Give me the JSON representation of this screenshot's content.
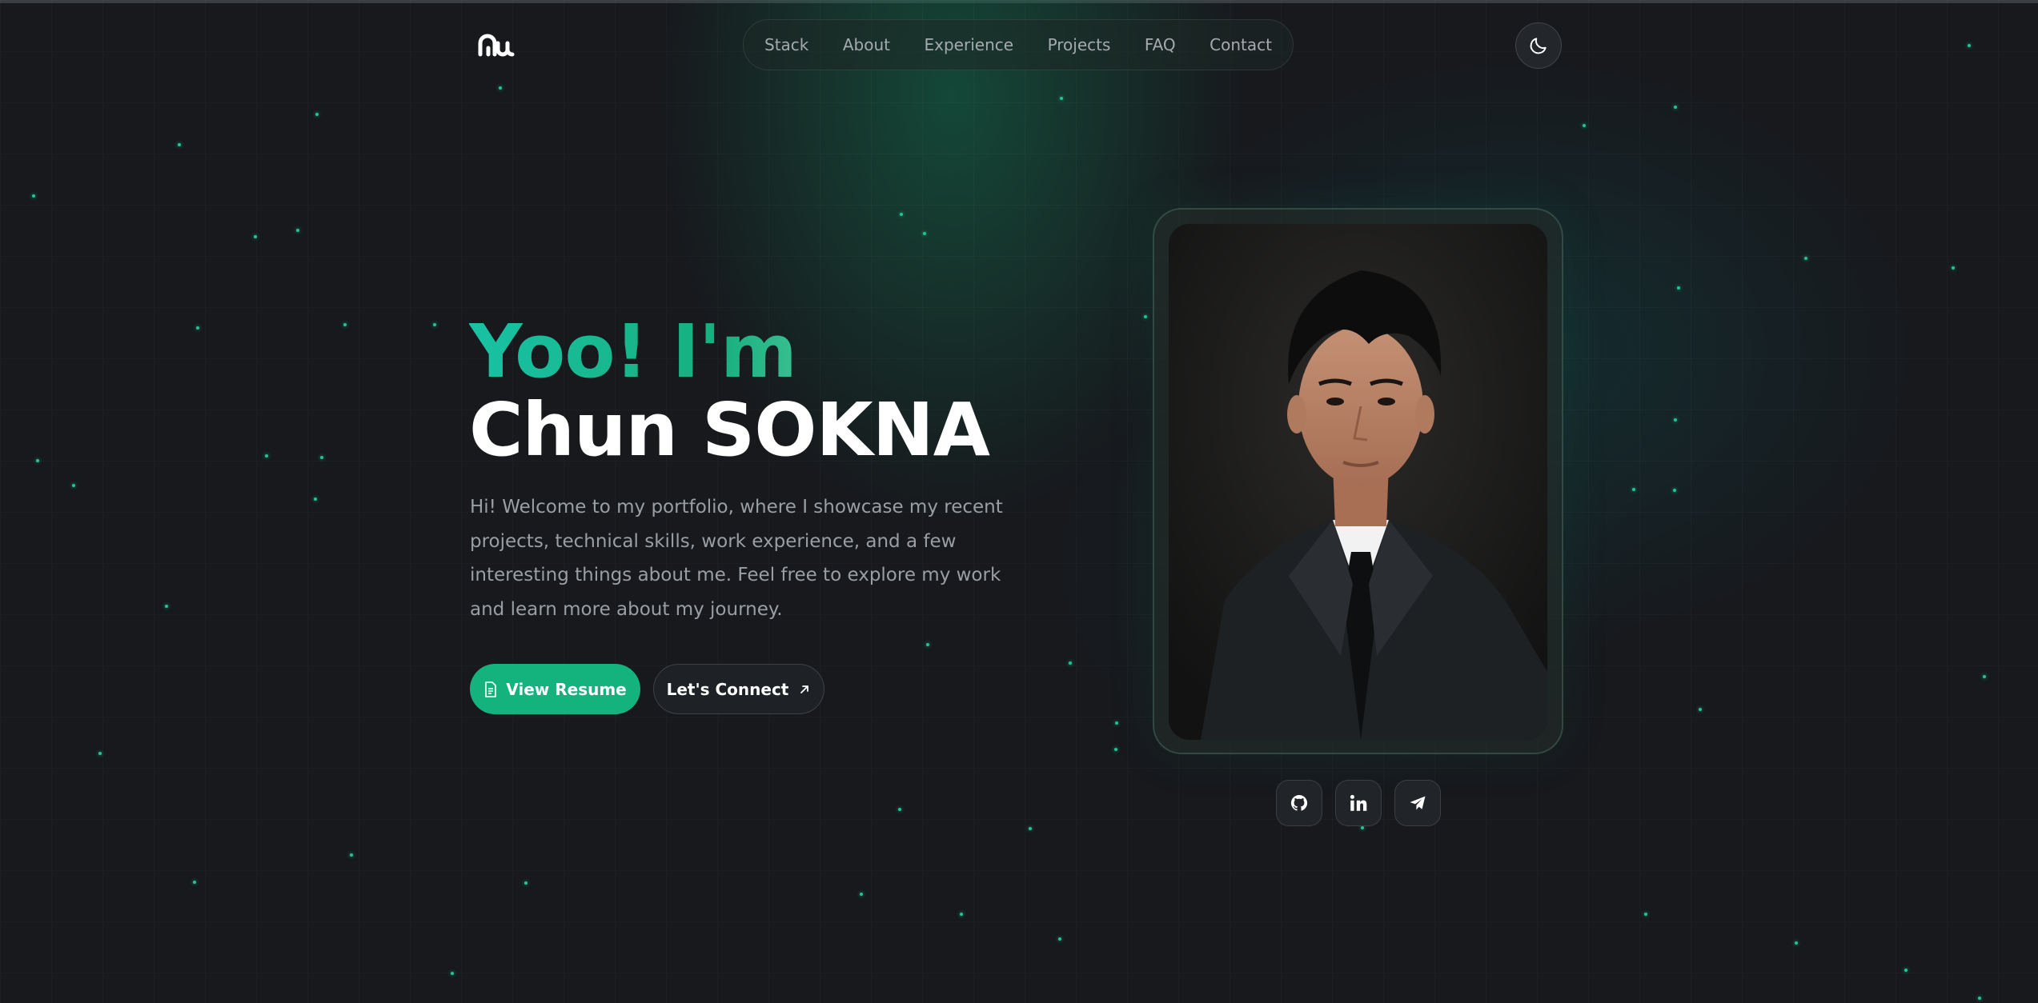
{
  "logo": {
    "icon": "aw-logo-icon"
  },
  "nav": {
    "items": [
      "Stack",
      "About",
      "Experience",
      "Projects",
      "FAQ",
      "Contact"
    ]
  },
  "theme_toggle": {
    "icon": "moon-icon"
  },
  "hero": {
    "greeting": "Yoo! I'm",
    "name": "Chun SOKNA",
    "description": "Hi! Welcome to my portfolio, where I showcase my recent projects, technical skills, work experience, and a few interesting things about me. Feel free to explore my work and learn more about my journey.",
    "primary_button": "View Resume",
    "secondary_button": "Let's Connect"
  },
  "socials": [
    {
      "icon": "github-icon"
    },
    {
      "icon": "linkedin-icon"
    },
    {
      "icon": "telegram-icon"
    }
  ],
  "colors": {
    "background": "#17191d",
    "accent": "#14b27c",
    "accent_teal": "#19c2a4",
    "text_muted": "#9a9fa3",
    "heading": "#ffffff"
  }
}
